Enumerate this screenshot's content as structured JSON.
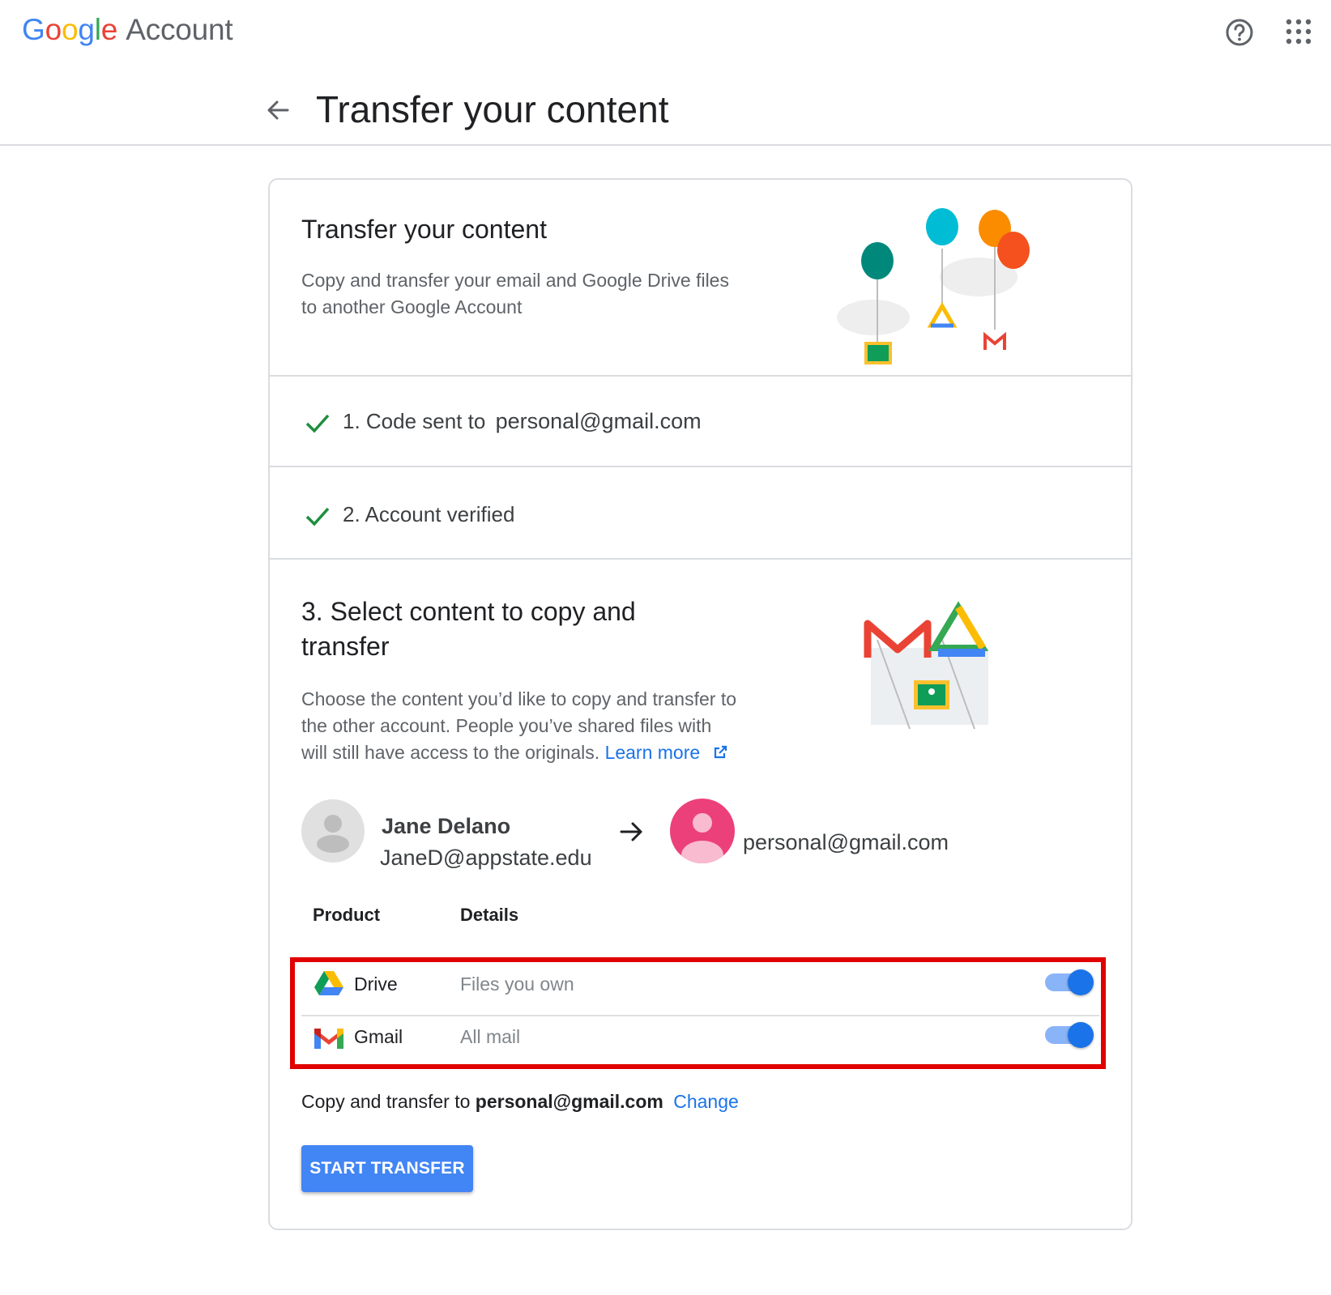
{
  "header": {
    "brand_letters": [
      "G",
      "o",
      "o",
      "g",
      "l",
      "e"
    ],
    "brand_suffix": "Account",
    "page_title": "Transfer your content",
    "help_icon": "help-circle-icon",
    "apps_icon": "apps-grid-icon",
    "back_icon": "arrow-back-icon"
  },
  "intro": {
    "title": "Transfer your content",
    "description_line1": "Copy and transfer your email and Google Drive files",
    "description_line2": "to another Google Account"
  },
  "steps": [
    {
      "label": "1. Code sent to",
      "value": "personal@gmail.com",
      "status_icon": "checkmark-icon"
    },
    {
      "label": "2. Account verified",
      "status_icon": "checkmark-icon"
    }
  ],
  "select": {
    "title_line1": "3. Select content to copy and",
    "title_line2": "transfer",
    "desc_line1": "Choose the content you’d like to copy and transfer to",
    "desc_line2": "the other account. People you’ve shared files with",
    "desc_line3": "will still have access to the originals.",
    "learn_more": "Learn more"
  },
  "source_account": {
    "name": "Jane Delano",
    "email": "JaneD@appstate.edu"
  },
  "destination_account": {
    "email": "personal@gmail.com"
  },
  "table": {
    "headers": [
      "Product",
      "Details"
    ],
    "rows": [
      {
        "product": "Drive",
        "details": "Files you own",
        "enabled": true
      },
      {
        "product": "Gmail",
        "details": "All mail",
        "enabled": true
      }
    ]
  },
  "footer": {
    "copy_prefix": "Copy and transfer to",
    "copy_target": "personal@gmail.com",
    "change_link": "Change",
    "start_button": "START TRANSFER"
  },
  "colors": {
    "primary": "#1a73e8",
    "button": "#4285f4",
    "highlight": "#e00000",
    "check": "#1e8e3e"
  }
}
